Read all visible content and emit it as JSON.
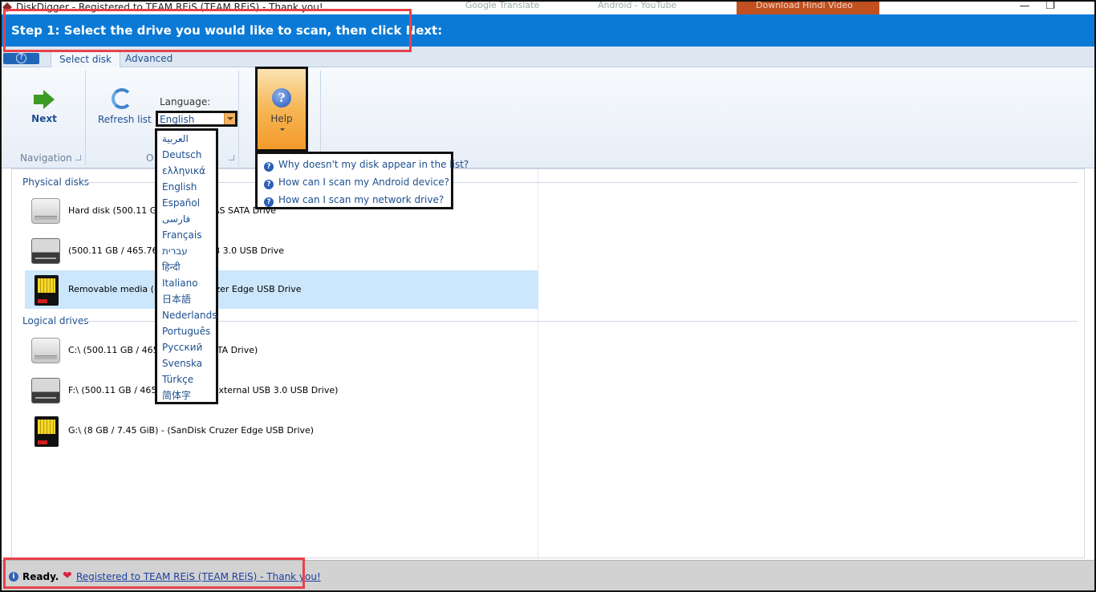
{
  "window": {
    "title": "DiskDigger - Registered to TEAM REiS (TEAM REiS) - Thank you!",
    "background_tabs": [
      "Google Translate",
      "Android - YouTube",
      "Download Hindi Video"
    ]
  },
  "step": {
    "title": "Step 1: Select the drive you would like to scan, then click Next:"
  },
  "ribbon": {
    "tabs": [
      {
        "label": "Select disk",
        "active": true
      },
      {
        "label": "Advanced",
        "active": false
      }
    ],
    "next_label": "Next",
    "refresh_label": "Refresh list",
    "language_label": "Language:",
    "language_value": "English",
    "help_label": "Help",
    "groups": {
      "navigation": "Navigation",
      "options": "O"
    }
  },
  "language_options": [
    "العربية",
    "Deutsch",
    "ελληνικά",
    "English",
    "Español",
    "فارسی",
    "Français",
    "עברית",
    "हिन्दी",
    "Italiano",
    "日本語",
    "Nederlands",
    "Português",
    "Русский",
    "Svenska",
    "Türkçe",
    "简体字"
  ],
  "help_menu": [
    "Why doesn't my disk appear in the list?",
    "How can I scan my Android device?",
    "How can I scan my network drive?"
  ],
  "physical_disks": {
    "header": "Physical disks",
    "items": [
      {
        "icon": "hard-disk-icon",
        "label": "Hard disk (500.11 GB / 4                              500420AS SATA Drive"
      },
      {
        "icon": "external-drive-icon",
        "label": " (500.11 GB / 465.76 GiB)                    rnal USB 3.0 USB Drive"
      },
      {
        "icon": "usb-drive-icon",
        "label": "Removable media (8 GB                              Disk Cruzer Edge USB Drive",
        "selected": true
      }
    ]
  },
  "logical_drives": {
    "header": "Logical drives",
    "items": [
      {
        "icon": "hard-disk-icon",
        "label": "C:\\ (500.11 GB / 465.76 G                        DAS SATA Drive)"
      },
      {
        "icon": "external-drive-icon",
        "label": "F:\\ (500.11 GB / 465.76 G                       SHIBA External USB 3.0 USB Drive)"
      },
      {
        "icon": "usb-drive-icon",
        "label": "G:\\ (8 GB / 7.45 GiB) -  (SanDisk Cruzer Edge USB Drive)"
      }
    ]
  },
  "status": {
    "text": "Ready.",
    "link": "Registered to TEAM REiS (TEAM REiS) - Thank you!"
  },
  "colors": {
    "banner": "#0a7ad6",
    "callout": "#e8414a",
    "selection": "#cce6fb",
    "help_gradient": "#f6b655"
  }
}
